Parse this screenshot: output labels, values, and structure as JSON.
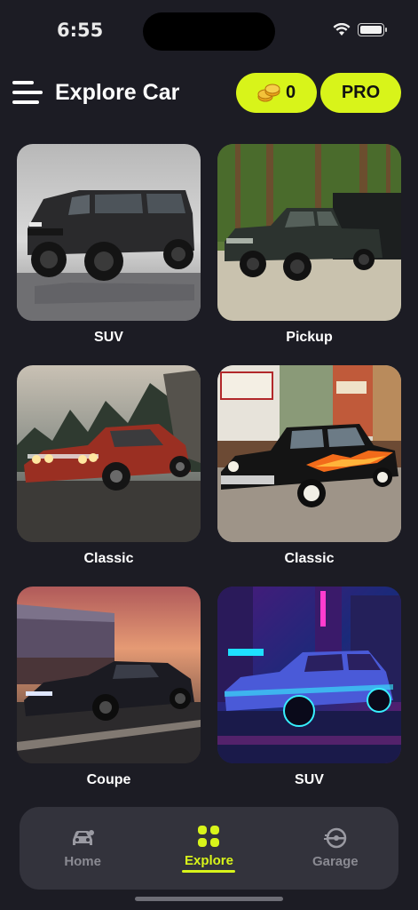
{
  "status": {
    "time": "6:55"
  },
  "header": {
    "title": "Explore Car",
    "coins": "0",
    "pro_label": "PRO"
  },
  "cards": [
    {
      "label": "SUV",
      "image": "black-suv-showroom"
    },
    {
      "label": "Pickup",
      "image": "dark-pickup-forest"
    },
    {
      "label": "Classic",
      "image": "red-muscle-car-mountain"
    },
    {
      "label": "Classic",
      "image": "black-hotrod-flames-street"
    },
    {
      "label": "Coupe",
      "image": "black-sedan-race-track"
    },
    {
      "label": "SUV",
      "image": "neon-suv-city"
    }
  ],
  "nav": {
    "items": [
      {
        "label": "Home",
        "icon": "car-icon",
        "active": false
      },
      {
        "label": "Explore",
        "icon": "grid-icon",
        "active": true
      },
      {
        "label": "Garage",
        "icon": "steering-icon",
        "active": false
      }
    ]
  },
  "colors": {
    "accent": "#d8f41a",
    "background": "#1c1c24",
    "nav_bg": "#33333c"
  }
}
